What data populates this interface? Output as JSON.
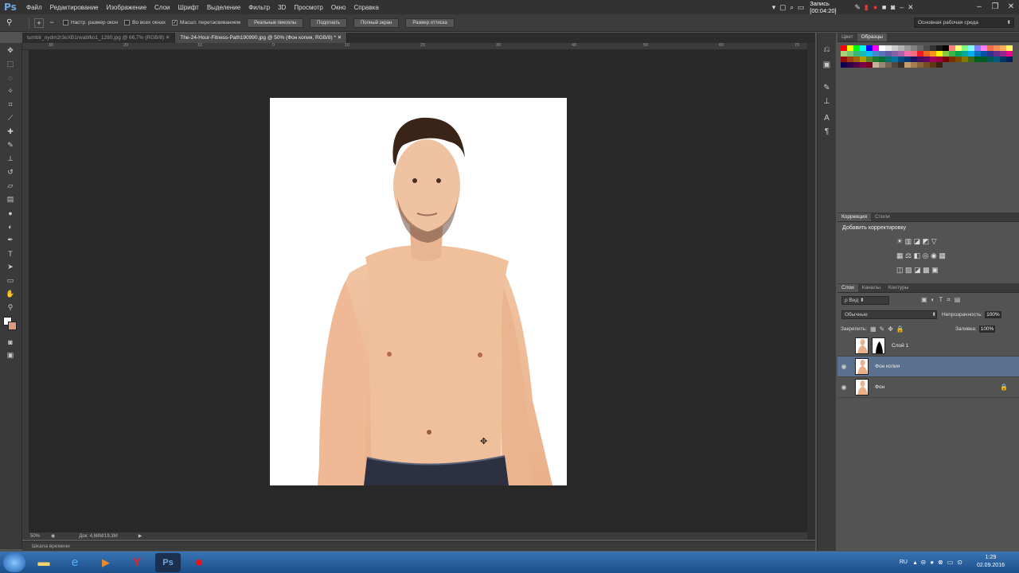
{
  "app": {
    "logo": "Ps"
  },
  "menu": [
    "Файл",
    "Редактирование",
    "Изображение",
    "Слои",
    "Шрифт",
    "Выделение",
    "Фильтр",
    "3D",
    "Просмотр",
    "Окно",
    "Справка"
  ],
  "recorder": {
    "label": "Запись [00:04:20]"
  },
  "options": {
    "resize_windows": "Настр. размер окон",
    "all_windows": "Во всех окнах",
    "scrubby_zoom": "Масшт. перетаскиванием",
    "actual_pixels": "Реальные пикселы",
    "fit_screen": "Подогнать",
    "full_screen": "Полный экран",
    "print_size": "Размер оттиска",
    "workspace": "Основная рабочая среда"
  },
  "tabs": [
    {
      "label": "tumblr_nydm2r3eXB1rwabfko1_1280.jpg @ 66,7% (RGB/8)",
      "active": false
    },
    {
      "label": "The-24-Hour-Fitness-Path190990.jpg @ 50% (Фон копия, RGB/8) *",
      "active": true
    }
  ],
  "ruler_top": [
    "30",
    "20",
    "10",
    "0",
    "10",
    "20",
    "30",
    "40",
    "50",
    "60",
    "70"
  ],
  "status": {
    "zoom": "50%",
    "doc": "Док: 4,68M/19,3M"
  },
  "timeline": "Шкала времени",
  "swatches_panel": {
    "tab_color": "Цвет",
    "tab_swatches": "Образцы"
  },
  "adjustments_panel": {
    "tab_adj": "Коррекция",
    "tab_styles": "Стили",
    "add_label": "Добавить корректировку"
  },
  "layers_panel": {
    "tab_layers": "Слои",
    "tab_channels": "Каналы",
    "tab_paths": "Контуры",
    "filter_kind": "Вид",
    "blend_mode": "Обычные",
    "opacity_label": "Непрозрачность:",
    "opacity_value": "100%",
    "lock_label": "Закрепить:",
    "fill_label": "Заливка:",
    "fill_value": "100%",
    "layers": [
      {
        "name": "Слой 1",
        "visible": false,
        "selected": false,
        "mask": true,
        "locked": false
      },
      {
        "name": "Фон копия",
        "visible": true,
        "selected": true,
        "mask": false,
        "locked": false
      },
      {
        "name": "Фон",
        "visible": true,
        "selected": false,
        "mask": false,
        "locked": true
      }
    ]
  },
  "taskbar": {
    "lang": "RU",
    "time": "1:29",
    "date": "02.09.2016"
  },
  "colors": {
    "accent": "#5b6f8e",
    "taskbar": "#2a5f9e",
    "ps_blue": "#6fa8e0"
  }
}
